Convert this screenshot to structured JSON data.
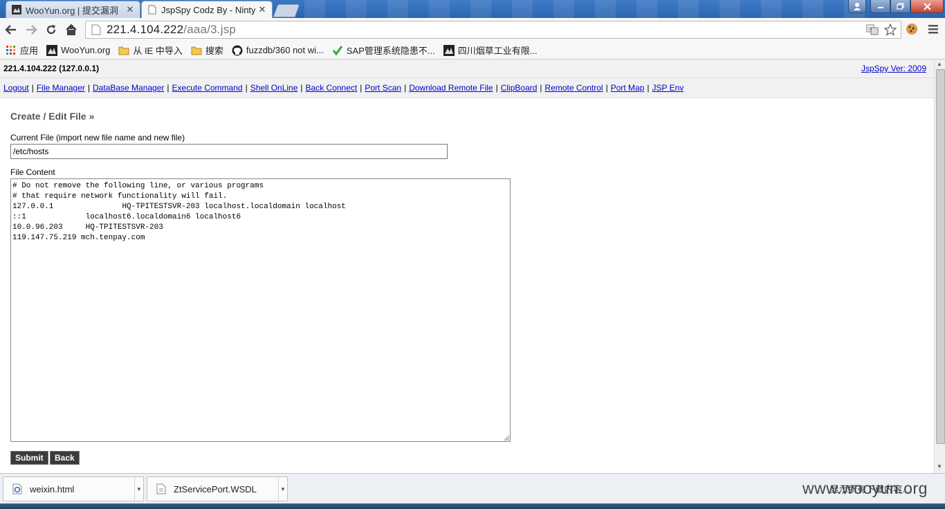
{
  "browser": {
    "tabs": [
      {
        "title": "WooYun.org | 提交漏洞",
        "active": false
      },
      {
        "title": "JspSpy Codz By - Ninty",
        "active": true
      }
    ],
    "url_host": "221.4.104.222",
    "url_path": "/aaa/3.jsp",
    "bookmarks": [
      {
        "label": "应用",
        "icon": "apps-grid-icon"
      },
      {
        "label": "WooYun.org",
        "icon": "wooyun-icon"
      },
      {
        "label": "从 IE 中导入",
        "icon": "folder-icon"
      },
      {
        "label": "搜索",
        "icon": "folder-icon"
      },
      {
        "label": "fuzzdb/360 not wi...",
        "icon": "github-icon"
      },
      {
        "label": "SAP管理系统隐患不...",
        "icon": "check-icon"
      },
      {
        "label": "四川烟草工业有限...",
        "icon": "wooyun-icon"
      }
    ]
  },
  "page": {
    "host": "221.4.104.222 (127.0.0.1)",
    "version": "JspSpy Ver: 2009",
    "nav_links": [
      "Logout",
      "File Manager",
      "DataBase Manager",
      "Execute Command",
      "Shell OnLine",
      "Back Connect",
      "Port Scan",
      "Download Remote File",
      "ClipBoard",
      "Remote Control",
      "Port Map",
      "JSP Env"
    ],
    "heading": "Create / Edit File »",
    "current_file_label": "Current File (import new file name and new file)",
    "current_file_value": "/etc/hosts",
    "content_label": "File Content",
    "content_text": "# Do not remove the following line, or various programs\n# that require network functionality will fail.\n127.0.0.1\t\tHQ-TPITESTSVR-203 localhost.localdomain localhost\n::1\t\tlocalhost6.localdomain6 localhost6\n10.0.96.203\tHQ-TPITESTSVR-203\n119.147.75.219 mch.tenpay.com",
    "submit_label": "Submit",
    "back_label": "Back"
  },
  "downloads": [
    {
      "name": "weixin.html",
      "icon": "ie-document-icon"
    },
    {
      "name": "ZtServicePort.WSDL",
      "icon": "document-icon"
    }
  ],
  "show_all_label": "显示所有下载内容...",
  "watermark": "www.wooyun.org"
}
